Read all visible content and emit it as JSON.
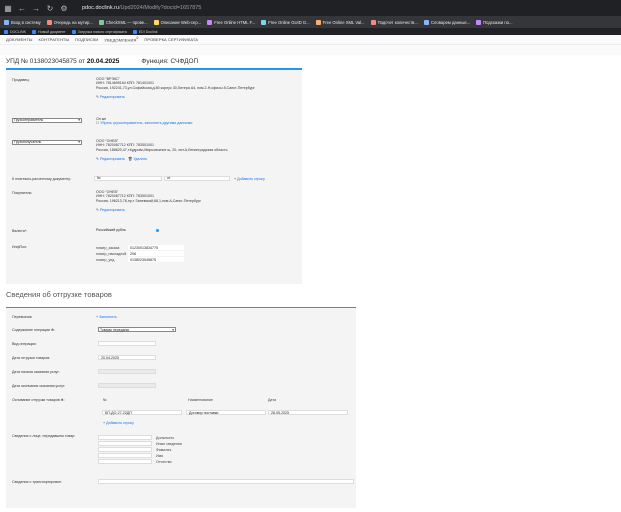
{
  "browser": {
    "url_host": "pdoc.doclink.ru",
    "url_path": "/Upd2024/Modify?docid=1657875",
    "bookmarks": [
      "Вход в систему",
      "Очередь на мутир...",
      "CheckXML — прове...",
      "Описание Web-сер...",
      "Free Online HTML F...",
      "Free Online GUID G...",
      "Free Online XML Val...",
      "Подсчет количеств...",
      "Словарем данные...",
      "Подсказки по..."
    ],
    "extensions": [
      "DOCLINK",
      "Новый документ",
      "Загрузка нового сертификата",
      "EDI Doclink"
    ]
  },
  "nav": [
    "ДОКУМЕНТЫ",
    "КОНТРАГЕНТЫ",
    "ПОДПИСКИ",
    "УВЕДОМЛЕНИЯ",
    "ПРОВЕРКА СЕРТИФИКАТА"
  ],
  "nav_badge": "0",
  "doc": {
    "number_label": "УПД №",
    "number": "0138023045875",
    "from": "от",
    "date": "20.04.2025",
    "func_label": "Функция:",
    "func": "СЧФДОП"
  },
  "seller": {
    "label": "Продавец:",
    "name": "ООО \"ВРЭКС\"",
    "inn": "ИНН: 7814699164 КПП: 781401001",
    "address": "Россия, 192241,73,ул.Софийская,д.80 корпус 30,Литера А4, пом.2-Н,офисы 8,Санкт-Петербург",
    "edit": "Редактировать"
  },
  "shipper": {
    "select": "Грузоотправитель",
    "same": "Он же",
    "hint": "Убрать грузоотправитель, заполнить другими данными"
  },
  "consignee": {
    "select": "Грузополучатель",
    "name": "ООО \"ОНЕВ\"",
    "inn": "ИНН: 7820087712 КПП: 783501001",
    "address": "Россия, 188620,47,г.Кудрово,Мирсовскное ш, 20, лит.А,Ленинградская область",
    "edit": "Редактировать",
    "delete": "Удалить"
  },
  "payment_doc": {
    "label": "К платежно-расчетному документу:",
    "num_prefix": "№",
    "date_prefix": "от",
    "add": "Добавить строку"
  },
  "buyer": {
    "label": "Покупатель:",
    "name": "ООО \"ОНЕВ\"",
    "inn": "ИНН: 7820087712 КПП: 783501001",
    "address": "Россия, 196213,78,пр-т Заневский,68,1,пом.А,Санкт-Петербург",
    "edit": "Редактировать"
  },
  "currency": {
    "label": "Валюта*:",
    "value": "Российский рубль"
  },
  "info": {
    "label": "ИнфПол:",
    "rows": [
      {
        "k": "номер_заказа",
        "v": "01230013834775"
      },
      {
        "k": "номер_накладной",
        "v": "206"
      },
      {
        "k": "номер_упд",
        "v": "0138023045875"
      }
    ]
  },
  "shipment": {
    "title": "Сведения об отгрузке товаров",
    "carrier": {
      "label": "Перевозчик:",
      "add": "Заполнить"
    },
    "operation": {
      "label": "Содержание операции ✻:",
      "value": "Товары переданы"
    },
    "op_type": "Вид операции:",
    "ship_date": {
      "label": "Дата отгрузки товаров:",
      "value": "20.04.2025"
    },
    "start_date": "Дата начала оказания услуг:",
    "end_date": "Дата окончания оказания услуг:",
    "basis": {
      "label": "Основание отгрузки товаров ✻:",
      "cols": [
        "№",
        "Наименование",
        "Дата"
      ],
      "num": "БП-ДО-27-22ДП",
      "name": "Договор поставки",
      "date": "28.05.2025",
      "add": "Добавить строку"
    },
    "person": {
      "label": "Сведения о лице, передавшем товар:",
      "fields": [
        "Должность",
        "Иные сведения",
        "Фамилия",
        "Имя",
        "Отчество"
      ]
    },
    "transport": "Сведения о транспортировке:"
  }
}
